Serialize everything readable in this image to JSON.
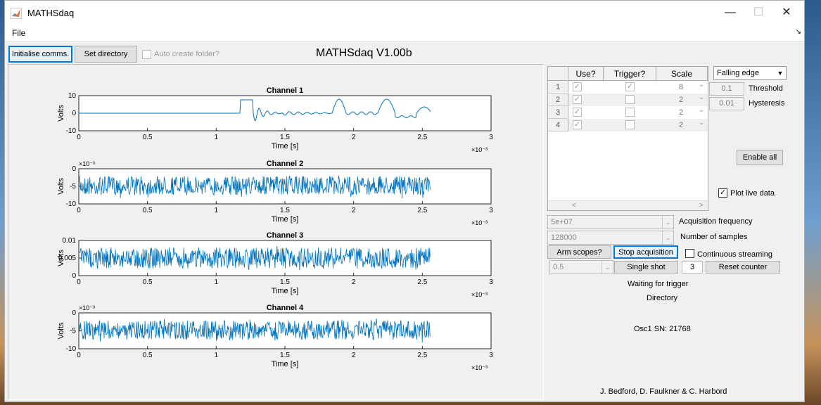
{
  "window": {
    "title": "MATHSdaq",
    "minimize": "—",
    "maximize": "☐",
    "close": "✕"
  },
  "menu": {
    "file": "File",
    "undock": "↘"
  },
  "toolbar": {
    "init_label": "Initialise comms.",
    "setdir_label": "Set directory",
    "autocreate_label": "Auto create folder?",
    "autocreate_checked": false
  },
  "app_title": "MATHSdaq V1.00b",
  "colors": {
    "trace": "#0072bd",
    "accent": "#0078d7"
  },
  "plots": [
    {
      "title": "Channel 1",
      "ylabel": "Volts",
      "xlabel": "Time [s]",
      "exponent_x": "×10⁻³",
      "exponent_y": "",
      "yticks": [
        "10",
        "0",
        "-10"
      ],
      "xticks": [
        "0",
        "0.5",
        "1",
        "1.5",
        "2",
        "2.5",
        "3"
      ]
    },
    {
      "title": "Channel 2",
      "ylabel": "Volts",
      "xlabel": "Time [s]",
      "exponent_x": "×10⁻³",
      "exponent_y": "×10⁻³",
      "yticks": [
        "0",
        "-5",
        "-10"
      ],
      "xticks": [
        "0",
        "0.5",
        "1",
        "1.5",
        "2",
        "2.5",
        "3"
      ]
    },
    {
      "title": "Channel 3",
      "ylabel": "Volts",
      "xlabel": "Time [s]",
      "exponent_x": "×10⁻³",
      "exponent_y": "",
      "yticks": [
        "0.01",
        "0.005",
        "0"
      ],
      "xticks": [
        "0",
        "0.5",
        "1",
        "1.5",
        "2",
        "2.5",
        "3"
      ]
    },
    {
      "title": "Channel 4",
      "ylabel": "Volts",
      "xlabel": "Time [s]",
      "exponent_x": "×10⁻³",
      "exponent_y": "×10⁻³",
      "yticks": [
        "0",
        "-5",
        "-10"
      ],
      "xticks": [
        "0",
        "0.5",
        "1",
        "1.5",
        "2",
        "2.5",
        "3"
      ]
    }
  ],
  "channel_table": {
    "headers": {
      "use": "Use?",
      "trigger": "Trigger?",
      "scale": "Scale"
    },
    "rows": [
      {
        "num": "1",
        "use": true,
        "trigger": true,
        "scale": "8"
      },
      {
        "num": "2",
        "use": true,
        "trigger": false,
        "scale": "2"
      },
      {
        "num": "3",
        "use": true,
        "trigger": false,
        "scale": "2"
      },
      {
        "num": "4",
        "use": true,
        "trigger": false,
        "scale": "2"
      }
    ],
    "scroll_left": "<",
    "scroll_right": ">"
  },
  "trigger": {
    "edge": "Falling edge",
    "threshold_value": "0.1",
    "threshold_label": "Threshold",
    "hysteresis_value": "0.01",
    "hysteresis_label": "Hysteresis"
  },
  "enable_all_label": "Enable all",
  "plot_live": {
    "label": "Plot live data",
    "checked": true
  },
  "acquisition": {
    "frequency_value": "5e+07",
    "frequency_label": "Acquisition frequency",
    "samples_value": "128000",
    "samples_label": "Number of samples"
  },
  "controls": {
    "arm_label": "Arm scopes?",
    "stop_label": "Stop acquisition",
    "continuous_label": "Continuous streaming",
    "continuous_checked": false,
    "interval_value": "0.5",
    "single_shot_label": "Single shot",
    "counter_value": "3",
    "reset_label": "Reset counter"
  },
  "status": {
    "state": "Waiting for trigger",
    "directory": "Directory",
    "serial": "Osc1 SN: 21768",
    "credits": "J. Bedford, D. Faulkner & C. Harbord"
  }
}
